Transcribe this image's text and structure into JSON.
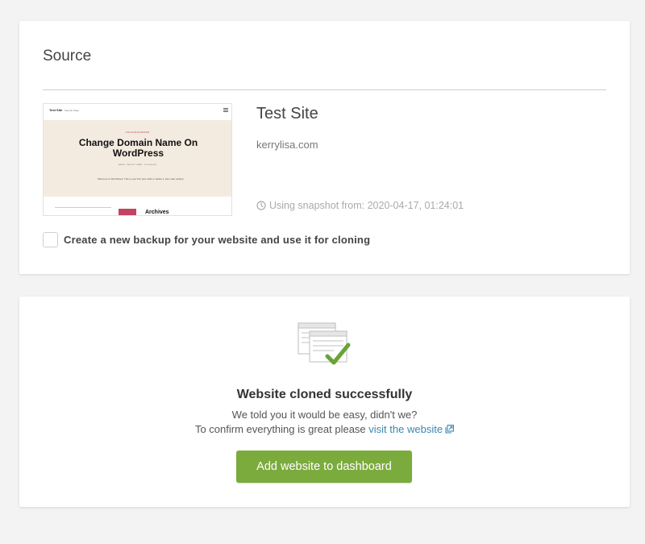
{
  "source": {
    "title": "Source",
    "thumbnail": {
      "site_name": "Test Site",
      "nav": "Sample Page",
      "category": "UNCATEGORIZED",
      "heading": "Change Domain Name On WordPress",
      "meta": "admin · April 17, 2020 · 1 Comment",
      "excerpt": "Welcome to WordPress. This is your first post. Edit or delete it, then start writing!",
      "sidebar_heading": "Archives"
    },
    "site_title": "Test Site",
    "domain": "kerrylisa.com",
    "snapshot": "Using snapshot from: 2020-04-17, 01:24:01",
    "backup_checkbox_label": "Create a new backup for your website and use it for cloning"
  },
  "result": {
    "title": "Website cloned successfully",
    "line1": "We told you it would be easy, didn't we?",
    "line2_prefix": "To confirm everything is great please ",
    "visit_link": "visit the website",
    "add_button": "Add website to dashboard"
  },
  "colors": {
    "accent_green": "#7bab3d",
    "link_blue": "#3a87b1",
    "check_green": "#6aa336"
  },
  "icons": {
    "snapshot": "clock-icon",
    "visit": "external-link-icon",
    "success": "cloned-pages-check-icon"
  }
}
